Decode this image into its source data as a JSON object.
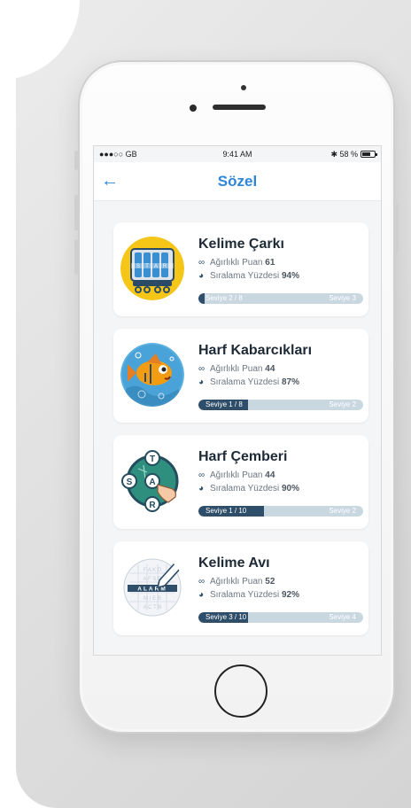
{
  "status": {
    "carrier": "●●●○○ GB",
    "time": "9:41 AM",
    "battery": "58 %"
  },
  "nav": {
    "back_icon": "←",
    "title": "Sözel"
  },
  "labels": {
    "weighted": "Ağırlıklı Puan",
    "rank": "Sıralama Yüzdesi",
    "weighted_icon": "link-icon",
    "rank_icon": "pie-icon"
  },
  "games": [
    {
      "title": "Kelime Çarkı",
      "points": "61",
      "percent": "94%",
      "level_left": "Seviye  2 / 8",
      "level_right": "Seviye  3",
      "progress": 0.04
    },
    {
      "title": "Harf Kabarcıkları",
      "points": "44",
      "percent": "87%",
      "level_left": "Seviye  1 / 8",
      "level_right": "Seviye  2",
      "progress": 0.3
    },
    {
      "title": "Harf Çemberi",
      "points": "44",
      "percent": "90%",
      "level_left": "Seviye  1 / 10",
      "level_right": "Seviye  2",
      "progress": 0.4
    },
    {
      "title": "Kelime Avı",
      "points": "52",
      "percent": "92%",
      "level_left": "Seviye  3 / 10",
      "level_right": "Seviye  4",
      "progress": 0.3
    }
  ],
  "thumb_letters": {
    "wheel": [
      "S",
      "T",
      "A",
      "R"
    ],
    "circle": [
      "T",
      "S",
      "A",
      "R"
    ],
    "grid_word": "ALARM",
    "grid_rows": [
      "F A K D",
      "A F S R",
      "M I E B",
      "A C T B"
    ]
  }
}
